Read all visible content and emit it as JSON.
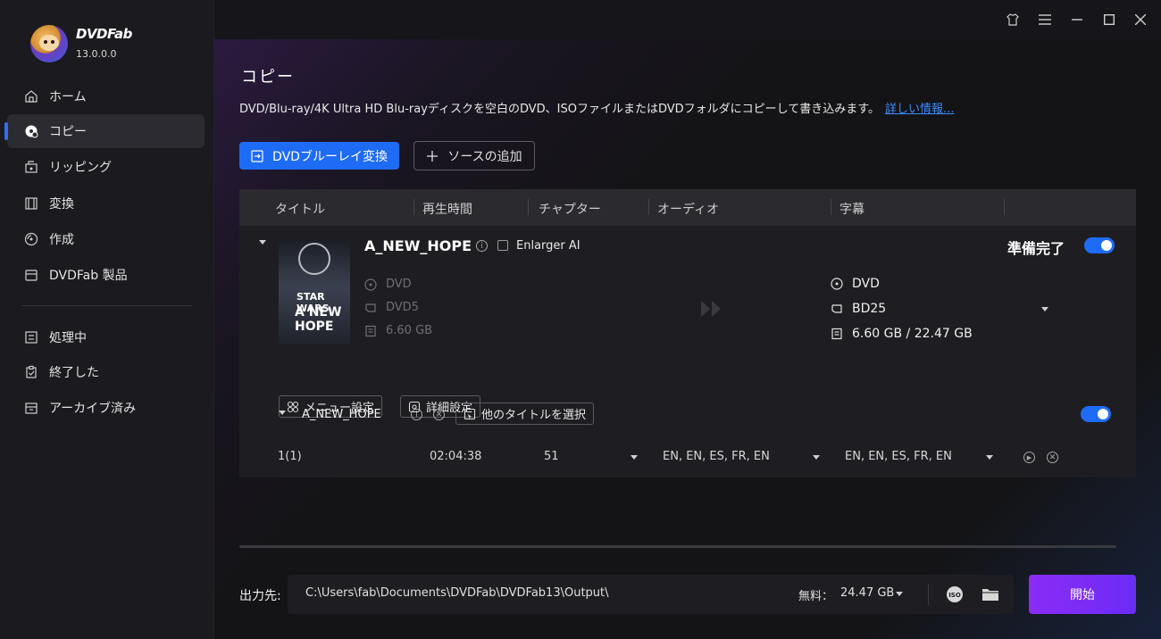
{
  "app": {
    "brand": "DVDFab",
    "version": "13.0.0.0"
  },
  "sidebar": {
    "items": [
      {
        "label": "ホーム",
        "icon": "home-icon"
      },
      {
        "label": "コピー",
        "icon": "disc-copy-icon"
      },
      {
        "label": "リッピング",
        "icon": "ripping-icon"
      },
      {
        "label": "変換",
        "icon": "film-icon"
      },
      {
        "label": "作成",
        "icon": "create-disc-icon"
      },
      {
        "label": "DVDFab 製品",
        "icon": "products-icon"
      },
      {
        "label": "処理中",
        "icon": "queue-icon"
      },
      {
        "label": "終了した",
        "icon": "finished-icon"
      },
      {
        "label": "アーカイブ済み",
        "icon": "archive-icon"
      }
    ],
    "active_index": 1
  },
  "window_controls": [
    "skin-icon",
    "menu-icon",
    "minimize-icon",
    "maximize-icon",
    "close-icon"
  ],
  "page": {
    "title": "コピー",
    "description": "DVD/Blu-ray/4K Ultra HD Blu-rayディスクを空白のDVD、ISOファイルまたはDVDフォルダにコピーして書き込みます。",
    "more_link": "詳しい情報..."
  },
  "toolbar": {
    "primary_label": "DVDブルーレイ変換",
    "add_source_label": "ソースの追加"
  },
  "table": {
    "headers": [
      "タイトル",
      "再生時間",
      "チャプター",
      "オーディオ",
      "字幕"
    ]
  },
  "disc": {
    "title": "A_NEW_HOPE",
    "enlarger_label": "Enlarger AI",
    "status": "準備完了",
    "enabled": true,
    "cover_text_small": "STAR WARS",
    "cover_text_large": "A NEW HOPE",
    "source": {
      "format": "DVD",
      "type": "DVD5",
      "size": "6.60 GB"
    },
    "target": {
      "format": "DVD",
      "type": "BD25",
      "size": "6.60 GB / 22.47 GB"
    },
    "menu_settings_label": "メニュー設定",
    "advanced_settings_label": "詳細設定"
  },
  "title_section": {
    "name": "A_NEW_HOPE",
    "select_other_label": "他のタイトルを選択",
    "enabled": true,
    "rows": [
      {
        "title": "1(1)",
        "duration": "02:04:38",
        "chapters": "51",
        "audio": "EN, EN, ES, FR, EN",
        "subtitles": "EN, EN, ES, FR, EN"
      }
    ]
  },
  "output": {
    "label": "出力先:",
    "path": "C:\\Users\\fab\\Documents\\DVDFab\\DVDFab13\\Output\\",
    "free_label": "無料：",
    "free_value": "24.47 GB",
    "start_label": "開始"
  },
  "colors": {
    "accent": "#1e6cf5",
    "start_button": "#8b2cf5",
    "link": "#3d8bff"
  }
}
